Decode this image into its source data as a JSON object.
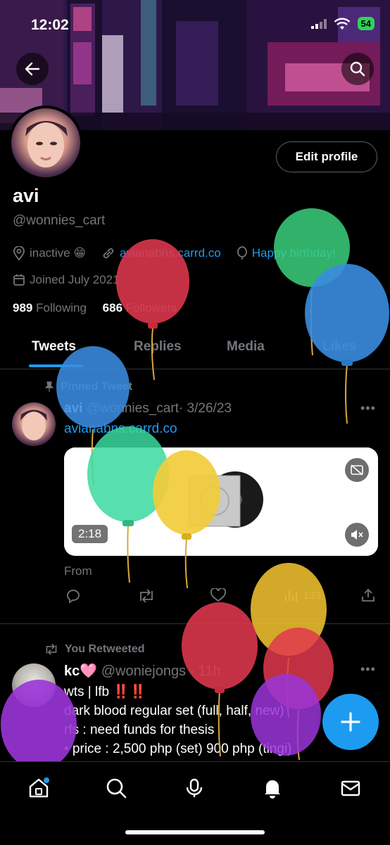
{
  "status_bar": {
    "time": "12:02",
    "battery": "54"
  },
  "profile": {
    "name": "avi",
    "handle": "@wonnies_cart",
    "edit_label": "Edit profile",
    "location": "inactive 😁",
    "website": "avianabns.carrd.co",
    "birthday": "Happy birthday!",
    "joined": "Joined July 2021",
    "following_count": "989",
    "following_label": "Following",
    "followers_count": "686",
    "followers_label": "Followers"
  },
  "tabs": [
    {
      "label": "Tweets",
      "active": true
    },
    {
      "label": "Replies"
    },
    {
      "label": "Media"
    },
    {
      "label": "Likes"
    }
  ],
  "pinned_tweet": {
    "context": "Pinned Tweet",
    "name": "avi",
    "handle": "@wonnies_cart",
    "date": "· 3/26/23",
    "link": "avianabns.carrd.co",
    "video_duration": "2:18",
    "from_label": "From",
    "views": "133"
  },
  "retweet": {
    "context": "You Retweeted",
    "name": "kc🩷",
    "handle": "@woniejongs",
    "time": "· 11h",
    "lines": [
      "wts | lfb ‼️‼️",
      "dark blood regular set (full, half, new)",
      "rfs : need funds for thesis",
      "• price : 2,500 php (set) 900 php (tingi)"
    ]
  },
  "colors": {
    "accent": "#1d9bf0",
    "background": "#000000",
    "muted_text": "#71767b",
    "divider": "#2f3336"
  },
  "icons": {
    "nav": [
      "home-icon",
      "search-icon",
      "spaces-icon",
      "notifications-icon",
      "messages-icon"
    ],
    "header": [
      "back-arrow-icon",
      "search-icon"
    ],
    "fab": "compose-plus-icon"
  }
}
